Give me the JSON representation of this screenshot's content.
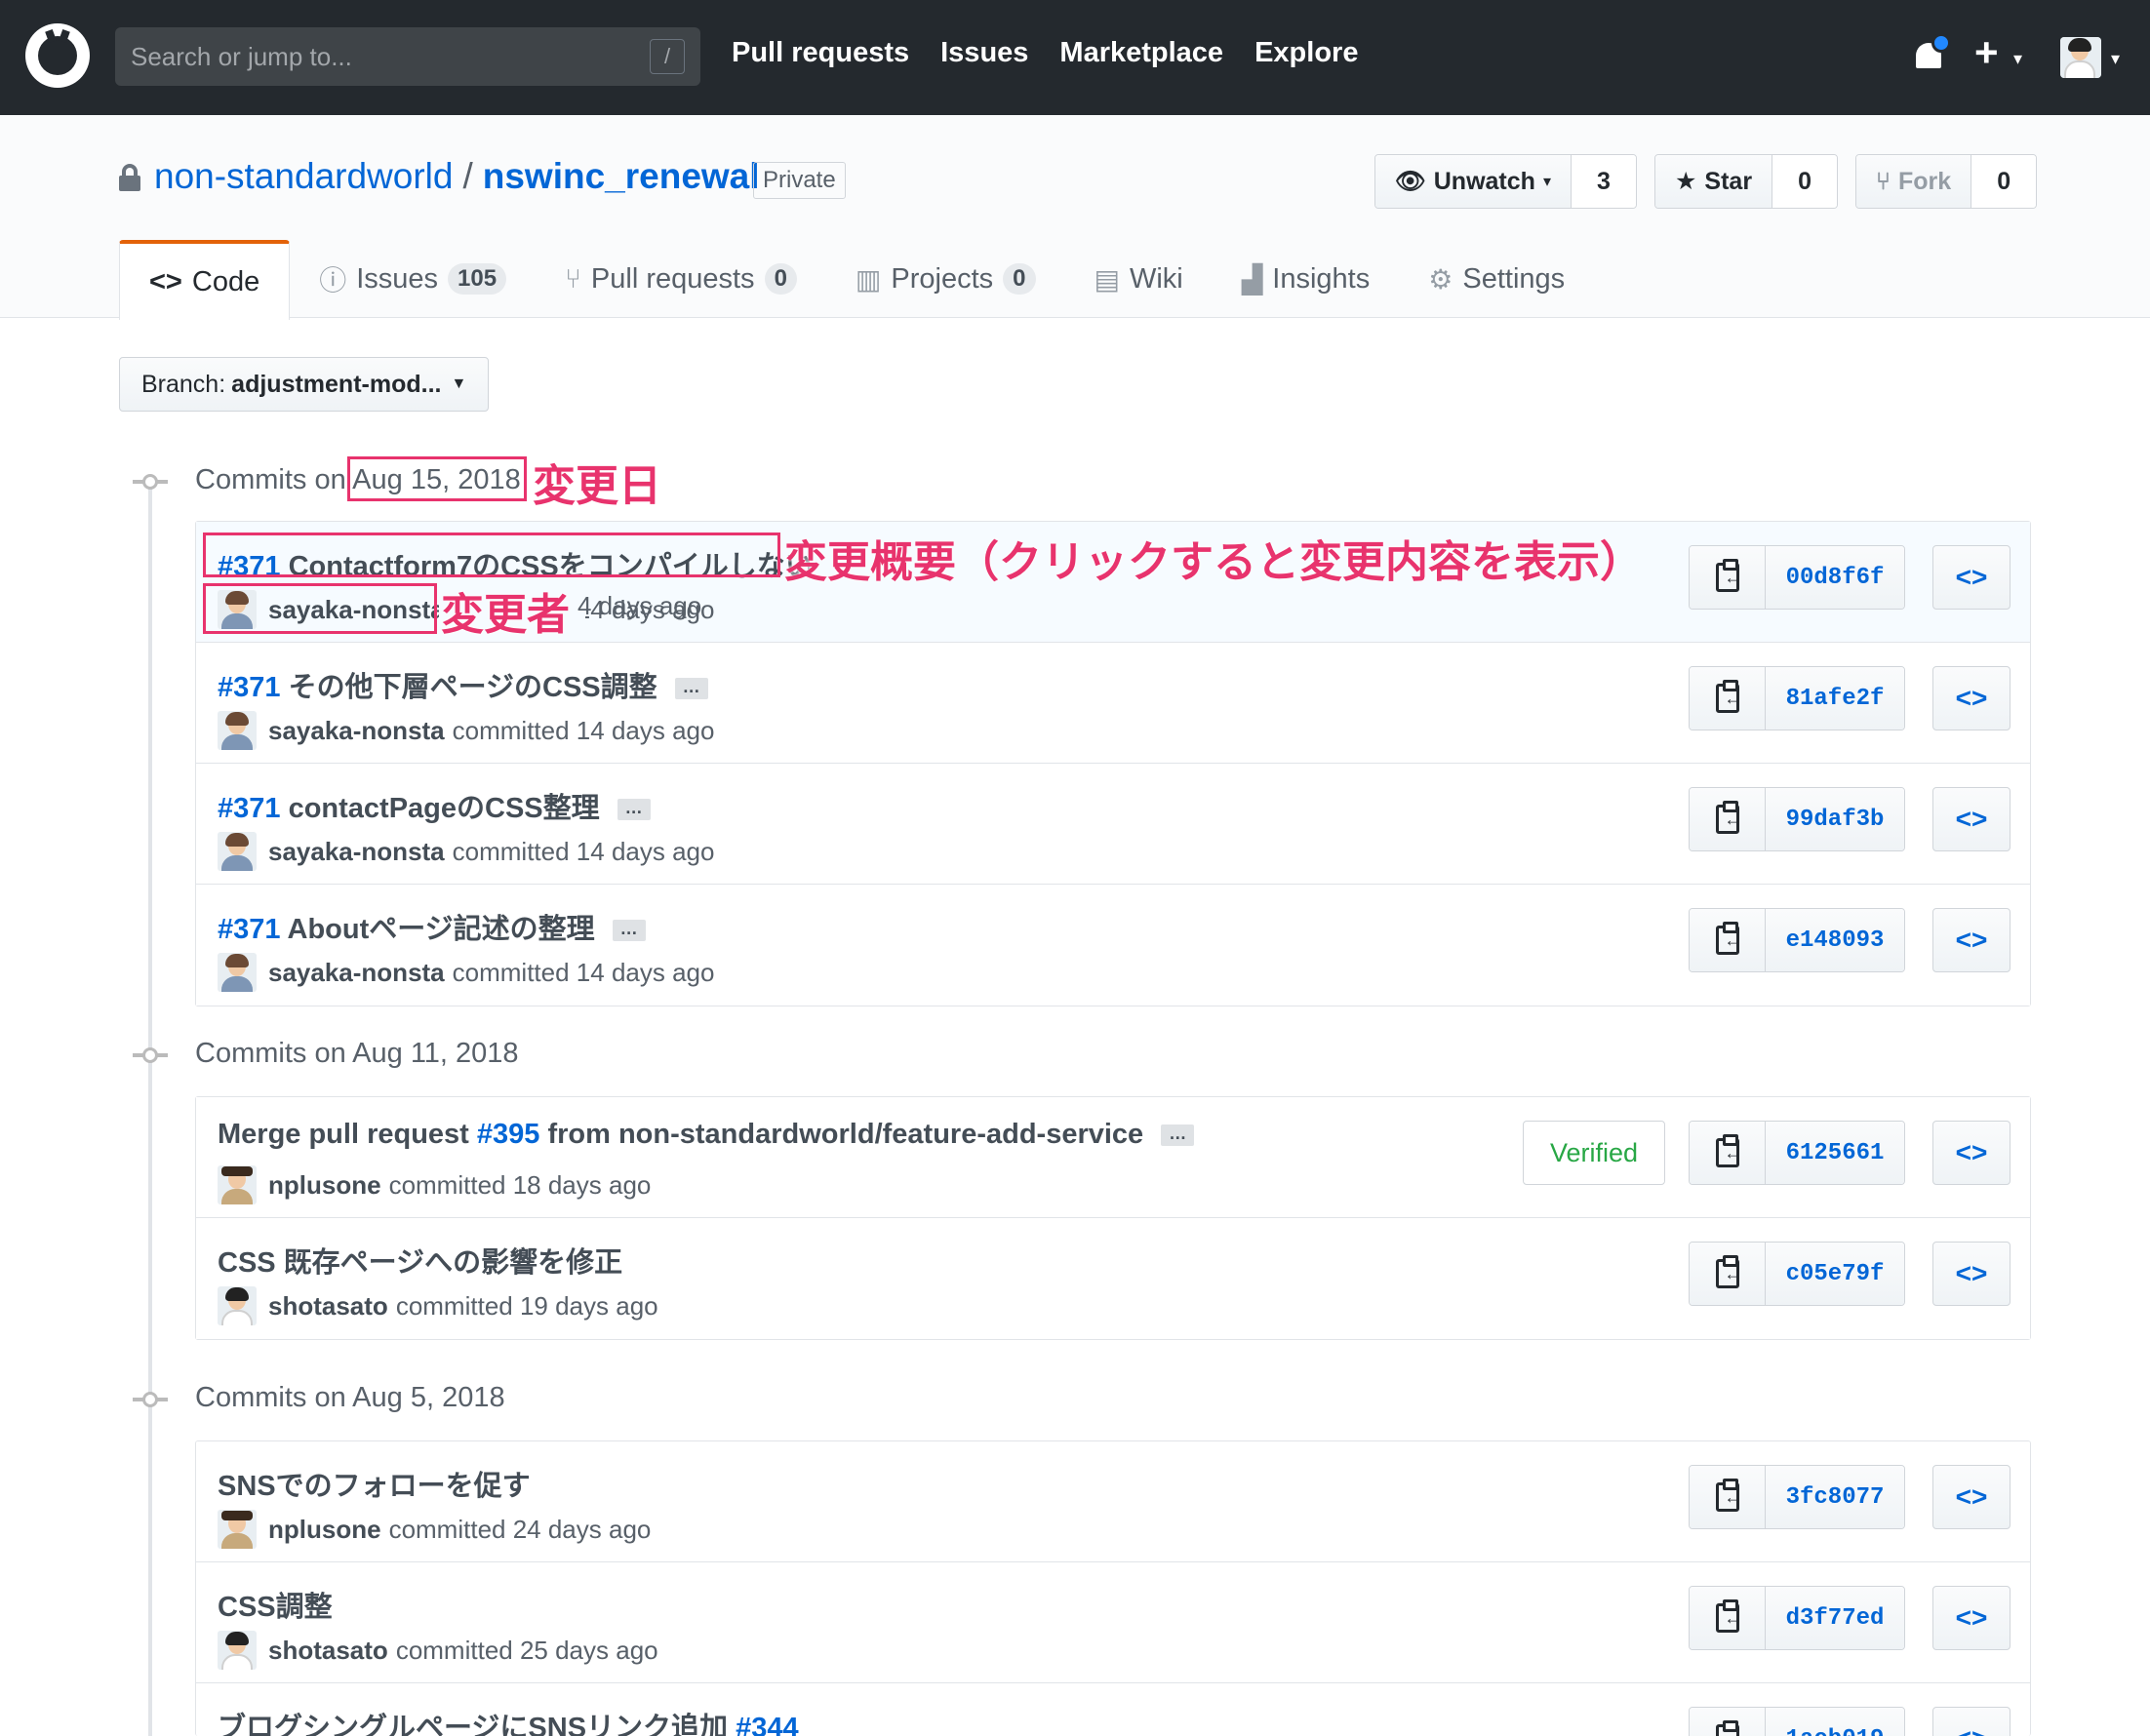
{
  "topbar": {
    "search_placeholder": "Search or jump to...",
    "slash": "/",
    "nav": [
      "Pull requests",
      "Issues",
      "Marketplace",
      "Explore"
    ]
  },
  "repo": {
    "owner": "non-standardworld",
    "separator": "/",
    "name": "nswinc_renewal",
    "visibility": "Private",
    "watch_label": "Unwatch",
    "watch_count": "3",
    "star_label": "Star",
    "star_count": "0",
    "fork_label": "Fork",
    "fork_count": "0"
  },
  "tabs": [
    {
      "label": "Code",
      "count": ""
    },
    {
      "label": "Issues",
      "count": "105"
    },
    {
      "label": "Pull requests",
      "count": "0"
    },
    {
      "label": "Projects",
      "count": "0"
    },
    {
      "label": "Wiki",
      "count": ""
    },
    {
      "label": "Insights",
      "count": ""
    },
    {
      "label": "Settings",
      "count": ""
    }
  ],
  "branch": {
    "prefix": "Branch:",
    "name": "adjustment-mod..."
  },
  "days": [
    {
      "prefix": "Commits on",
      "date": "Aug 15, 2018",
      "commits": [
        {
          "pr": "#371",
          "message": "Contactform7のCSSをコンパイルしない",
          "author": "sayaka-nonsta",
          "when": "committed 14 days ago",
          "sha": "00d8f6f"
        },
        {
          "pr": "#371",
          "message": "その他下層ページのCSS調整",
          "author": "sayaka-nonsta",
          "when": "committed 14 days ago",
          "sha": "81afe2f"
        },
        {
          "pr": "#371",
          "message": "contactPageのCSS整理",
          "author": "sayaka-nonsta",
          "when": "committed 14 days ago",
          "sha": "99daf3b"
        },
        {
          "pr": "#371",
          "message": "Aboutページ記述の整理",
          "author": "sayaka-nonsta",
          "when": "committed 14 days ago",
          "sha": "e148093"
        }
      ]
    },
    {
      "prefix": "Commits on",
      "date": "Aug 11, 2018",
      "commits": [
        {
          "message_pre": "Merge pull request",
          "pr": "#395",
          "message": "from non-standardworld/feature-add-service",
          "author": "nplusone",
          "when": "committed 18 days ago",
          "sha": "6125661",
          "badge": "Verified"
        },
        {
          "message": "CSS 既存ページへの影響を修正",
          "author": "shotasato",
          "when": "committed 19 days ago",
          "sha": "c05e79f"
        }
      ]
    },
    {
      "prefix": "Commits on",
      "date": "Aug 5, 2018",
      "commits": [
        {
          "message": "SNSでのフォローを促す",
          "author": "nplusone",
          "when": "committed 24 days ago",
          "sha": "3fc8077"
        },
        {
          "message": "CSS調整",
          "author": "shotasato",
          "when": "committed 25 days ago",
          "sha": "d3f77ed"
        },
        {
          "message": "ブログシングルページにSNSリンク追加",
          "pr": "#344",
          "sha": "1acb019"
        }
      ]
    }
  ],
  "annotations": {
    "date": "変更日",
    "summary": "変更概要（クリックすると変更内容を表示）",
    "author": "変更者",
    "when_overlay": "4 days ago"
  },
  "icons": {
    "copy": "clipboard-icon",
    "browse": "code-icon",
    "ellipsis": "…"
  }
}
